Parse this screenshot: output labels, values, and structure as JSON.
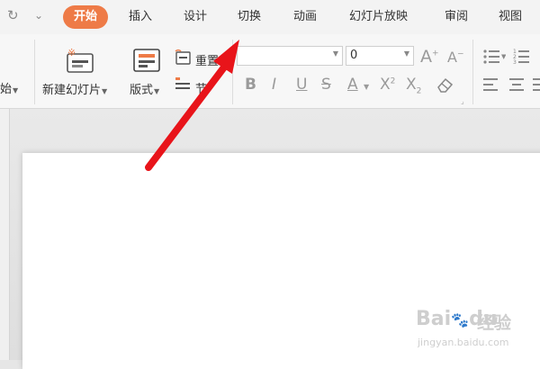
{
  "menubar": {
    "tabs": [
      {
        "label": "开始",
        "active": true
      },
      {
        "label": "插入"
      },
      {
        "label": "设计"
      },
      {
        "label": "切换"
      },
      {
        "label": "动画"
      },
      {
        "label": "幻灯片放映"
      },
      {
        "label": "审阅"
      },
      {
        "label": "视图"
      }
    ],
    "accent": "#ee7b47"
  },
  "ribbon": {
    "left_partial": "始",
    "new_slide": "新建幻灯片",
    "layout": "版式",
    "reset": "重置",
    "section_partial": "节",
    "font_size_value": "0",
    "increase_font": "A",
    "decrease_font": "A",
    "bold": "B",
    "italic": "I",
    "underline": "U",
    "strike": "S",
    "font_color": "A",
    "superscript": "X",
    "subscript": "X",
    "sup_mark": "2",
    "sub_mark": "2"
  },
  "watermark": {
    "brand": "Bai",
    "brand_tail": "du",
    "cn": "经验",
    "url": "jingyan.baidu.com"
  },
  "annotation_color": "#e8141a"
}
